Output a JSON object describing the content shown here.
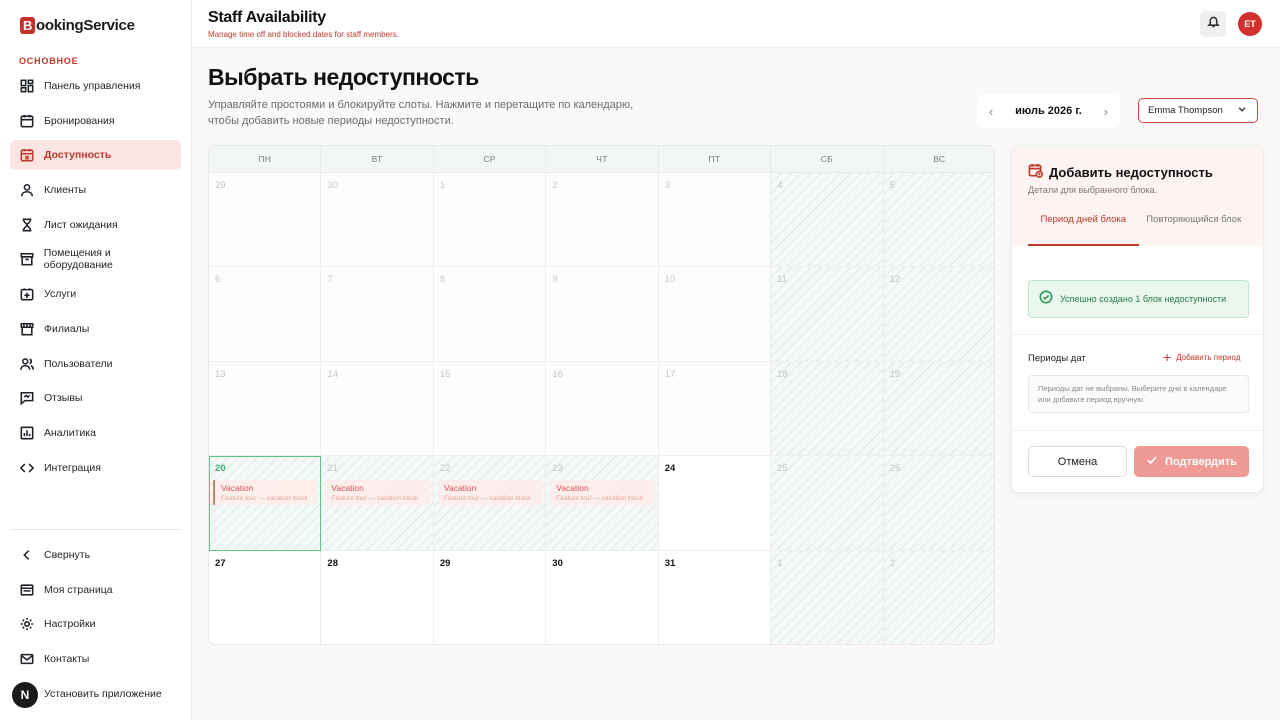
{
  "brand": {
    "initial": "B",
    "name": "ookingService"
  },
  "sidebar": {
    "section_label": "ОСНОВНОЕ",
    "items": [
      {
        "label": "Панель управления",
        "icon": "dashboard-icon"
      },
      {
        "label": "Бронирования",
        "icon": "calendar-icon"
      },
      {
        "label": "Доступность",
        "icon": "calendar-x-icon",
        "active": true
      },
      {
        "label": "Клиенты",
        "icon": "user-icon"
      },
      {
        "label": "Лист ожидания",
        "icon": "hourglass-icon"
      },
      {
        "label": "Помещения и оборудование",
        "icon": "archive-icon"
      },
      {
        "label": "Услуги",
        "icon": "plus-square-icon"
      },
      {
        "label": "Филиалы",
        "icon": "store-icon"
      },
      {
        "label": "Пользователи",
        "icon": "users-icon"
      },
      {
        "label": "Отзывы",
        "icon": "chat-icon"
      },
      {
        "label": "Аналитика",
        "icon": "chart-icon"
      },
      {
        "label": "Интеграция",
        "icon": "code-icon"
      }
    ],
    "bottom_items": [
      {
        "label": "Свернуть",
        "icon": "chevron-left-icon"
      },
      {
        "label": "Моя страница",
        "icon": "page-icon"
      },
      {
        "label": "Настройки",
        "icon": "gear-icon"
      },
      {
        "label": "Контакты",
        "icon": "mail-icon"
      },
      {
        "label": "Установить приложение",
        "icon": "download-icon"
      }
    ],
    "app_avatar": "N"
  },
  "topbar": {
    "title": "Staff Availability",
    "subtitle": "Manage time off and blocked dates for staff members.",
    "user_initials": "ET"
  },
  "page": {
    "title": "Выбрать недоступность",
    "description": "Управляйте простоями и блокируйте слоты. Нажмите и перетащите по календарю, чтобы добавить новые периоды недоступности."
  },
  "calendar": {
    "month_label": "июль 2026 г.",
    "prev_arrow": "‹",
    "next_arrow": "›",
    "staff_selected": "Emma Thompson",
    "weekdays": [
      "ПН",
      "ВТ",
      "СР",
      "ЧТ",
      "ПТ",
      "СБ",
      "ВС"
    ],
    "days": [
      {
        "n": "29",
        "state": "past"
      },
      {
        "n": "30",
        "state": "past"
      },
      {
        "n": "1",
        "state": "past"
      },
      {
        "n": "2",
        "state": "past"
      },
      {
        "n": "3",
        "state": "past"
      },
      {
        "n": "4",
        "state": "weekend"
      },
      {
        "n": "5",
        "state": "weekend"
      },
      {
        "n": "6",
        "state": "past"
      },
      {
        "n": "7",
        "state": "past"
      },
      {
        "n": "8",
        "state": "past"
      },
      {
        "n": "9",
        "state": "past"
      },
      {
        "n": "10",
        "state": "past"
      },
      {
        "n": "11",
        "state": "weekend"
      },
      {
        "n": "12",
        "state": "weekend"
      },
      {
        "n": "13",
        "state": "past"
      },
      {
        "n": "14",
        "state": "past"
      },
      {
        "n": "15",
        "state": "past"
      },
      {
        "n": "16",
        "state": "past"
      },
      {
        "n": "17",
        "state": "past"
      },
      {
        "n": "18",
        "state": "weekend"
      },
      {
        "n": "19",
        "state": "weekend"
      },
      {
        "n": "20",
        "state": "selected",
        "event": true
      },
      {
        "n": "21",
        "state": "blocked",
        "event": true
      },
      {
        "n": "22",
        "state": "blocked",
        "event": true
      },
      {
        "n": "23",
        "state": "blocked",
        "event": true
      },
      {
        "n": "24",
        "state": "current"
      },
      {
        "n": "25",
        "state": "weekend"
      },
      {
        "n": "26",
        "state": "weekend"
      },
      {
        "n": "27",
        "state": "current"
      },
      {
        "n": "28",
        "state": "current"
      },
      {
        "n": "29",
        "state": "current"
      },
      {
        "n": "30",
        "state": "current"
      },
      {
        "n": "31",
        "state": "current"
      },
      {
        "n": "1",
        "state": "weekend"
      },
      {
        "n": "2",
        "state": "weekend"
      }
    ],
    "event_title": "Vacation",
    "event_subtitle": "Feature tour — vacation block"
  },
  "panel": {
    "title": "Добавить недоступность",
    "subtitle": "Детали для выбранного блока.",
    "tabs": [
      "Период дней блока",
      "Повторяющийся блок"
    ],
    "success_message": "Успешно создано 1 блок недоступности",
    "periods_label": "Периоды дат",
    "add_period_label": "Добавить период",
    "empty_periods": "Периоды дат не выбраны. Выберите дни в календаре или добавьте период вручную.",
    "cancel_label": "Отмена",
    "confirm_label": "Подтвердить"
  },
  "colors": {
    "accent": "#c0392b",
    "success": "#2e9b5a",
    "selected_outline": "#5ec58a"
  }
}
